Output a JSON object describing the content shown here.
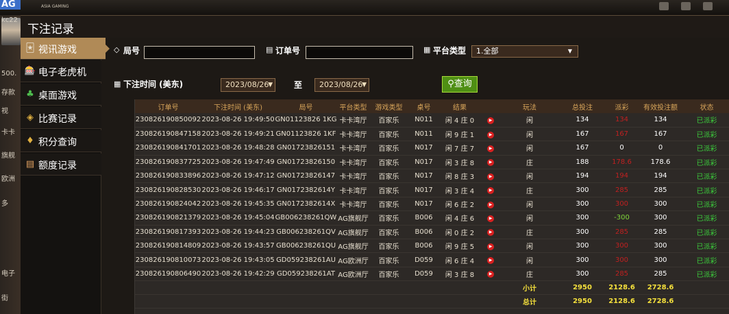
{
  "background": {
    "logo_text": "AG",
    "logo_sub": "ASIA GAMING",
    "left_snippets": [
      "kc22",
      "500.",
      "存款",
      "视",
      "卡卡",
      "旗舰",
      "欧洲",
      "多",
      "电子",
      "街"
    ]
  },
  "modal": {
    "title": "下注记录"
  },
  "sidebar": {
    "items": [
      {
        "label": "视讯游戏",
        "icon": "🃏"
      },
      {
        "label": "电子老虎机",
        "icon": "🎰"
      },
      {
        "label": "桌面游戏",
        "icon": "♣"
      },
      {
        "label": "比赛记录",
        "icon": "◈"
      },
      {
        "label": "积分查询",
        "icon": "♦"
      },
      {
        "label": "额度记录",
        "icon": "▤"
      }
    ]
  },
  "filters": {
    "round_label": "局号",
    "round_value": "",
    "order_label": "订单号",
    "order_value": "",
    "platform_label": "平台类型",
    "platform_value": "1.全部",
    "time_label": "下注时间 (美东)",
    "date_from": "2023/08/26",
    "to_label": "至",
    "date_to": "2023/08/26",
    "query_label": "查询"
  },
  "table": {
    "headers": [
      "订单号",
      "下注时间 (美东)",
      "局号",
      "平台类型",
      "游戏类型",
      "桌号",
      "结果",
      "",
      "玩法",
      "总投注",
      "派彩",
      "有效投注额",
      "状态"
    ],
    "rows": [
      {
        "order": "230826190850092",
        "time": "2023-08-26 19:49:50",
        "round": "GN01123826 1KG",
        "platform": "卡卡湾厅",
        "game": "百家乐",
        "table": "N011",
        "result": "闲 4 庄 0",
        "play": "闲",
        "bet": "134",
        "payout": "134",
        "payout_color": "red",
        "valid": "134",
        "status": "已派彩"
      },
      {
        "order": "230826190847158",
        "time": "2023-08-26 19:49:21",
        "round": "GN01123826 1KF",
        "platform": "卡卡湾厅",
        "game": "百家乐",
        "table": "N011",
        "result": "闲 9 庄 1",
        "play": "闲",
        "bet": "167",
        "payout": "167",
        "payout_color": "red",
        "valid": "167",
        "status": "已派彩"
      },
      {
        "order": "230826190841701",
        "time": "2023-08-26 19:48:28",
        "round": "GN01723826151",
        "platform": "卡卡湾厅",
        "game": "百家乐",
        "table": "N017",
        "result": "闲 7 庄 7",
        "play": "闲",
        "bet": "167",
        "payout": "0",
        "payout_color": "white",
        "valid": "0",
        "status": "已派彩"
      },
      {
        "order": "230826190837725",
        "time": "2023-08-26 19:47:49",
        "round": "GN01723826150",
        "platform": "卡卡湾厅",
        "game": "百家乐",
        "table": "N017",
        "result": "闲 3 庄 8",
        "play": "庄",
        "bet": "188",
        "payout": "178.6",
        "payout_color": "red",
        "valid": "178.6",
        "status": "已派彩"
      },
      {
        "order": "230826190833896",
        "time": "2023-08-26 19:47:12",
        "round": "GN01723826147",
        "platform": "卡卡湾厅",
        "game": "百家乐",
        "table": "N017",
        "result": "闲 8 庄 3",
        "play": "闲",
        "bet": "194",
        "payout": "194",
        "payout_color": "red",
        "valid": "194",
        "status": "已派彩"
      },
      {
        "order": "230826190828530",
        "time": "2023-08-26 19:46:17",
        "round": "GN0172382614Y",
        "platform": "卡卡湾厅",
        "game": "百家乐",
        "table": "N017",
        "result": "闲 3 庄 4",
        "play": "庄",
        "bet": "300",
        "payout": "285",
        "payout_color": "red",
        "valid": "285",
        "status": "已派彩"
      },
      {
        "order": "230826190824042",
        "time": "2023-08-26 19:45:35",
        "round": "GN0172382614X",
        "platform": "卡卡湾厅",
        "game": "百家乐",
        "table": "N017",
        "result": "闲 6 庄 2",
        "play": "闲",
        "bet": "300",
        "payout": "300",
        "payout_color": "red",
        "valid": "300",
        "status": "已派彩"
      },
      {
        "order": "230826190821379",
        "time": "2023-08-26 19:45:04",
        "round": "GB006238261QW",
        "platform": "AG旗舰厅",
        "game": "百家乐",
        "table": "B006",
        "result": "闲 4 庄 6",
        "play": "闲",
        "bet": "300",
        "payout": "-300",
        "payout_color": "green",
        "valid": "300",
        "status": "已派彩"
      },
      {
        "order": "230826190817393",
        "time": "2023-08-26 19:44:23",
        "round": "GB006238261QV",
        "platform": "AG旗舰厅",
        "game": "百家乐",
        "table": "B006",
        "result": "闲 0 庄 2",
        "play": "庄",
        "bet": "300",
        "payout": "285",
        "payout_color": "red",
        "valid": "285",
        "status": "已派彩"
      },
      {
        "order": "230826190814809",
        "time": "2023-08-26 19:43:57",
        "round": "GB006238261QU",
        "platform": "AG旗舰厅",
        "game": "百家乐",
        "table": "B006",
        "result": "闲 9 庄 5",
        "play": "闲",
        "bet": "300",
        "payout": "300",
        "payout_color": "red",
        "valid": "300",
        "status": "已派彩"
      },
      {
        "order": "230826190810073",
        "time": "2023-08-26 19:43:05",
        "round": "GD059238261AU",
        "platform": "AG欧洲厅",
        "game": "百家乐",
        "table": "D059",
        "result": "闲 6 庄 4",
        "play": "闲",
        "bet": "300",
        "payout": "300",
        "payout_color": "red",
        "valid": "300",
        "status": "已派彩"
      },
      {
        "order": "230826190806490",
        "time": "2023-08-26 19:42:29",
        "round": "GD059238261AT",
        "platform": "AG欧洲厅",
        "game": "百家乐",
        "table": "D059",
        "result": "闲 3 庄 8",
        "play": "庄",
        "bet": "300",
        "payout": "285",
        "payout_color": "red",
        "valid": "285",
        "status": "已派彩"
      }
    ],
    "subtotal": {
      "label": "小计",
      "bet": "2950",
      "payout": "2128.6",
      "valid": "2728.6"
    },
    "total": {
      "label": "总计",
      "bet": "2950",
      "payout": "2128.6",
      "valid": "2728.6"
    }
  },
  "colors": {
    "accent": "#b08a57",
    "header_text": "#d8a55a",
    "status_green": "#3ccc3c",
    "payout_red": "#c02020",
    "total_yellow": "#f5e03c",
    "query_button": "#4f8f14"
  }
}
